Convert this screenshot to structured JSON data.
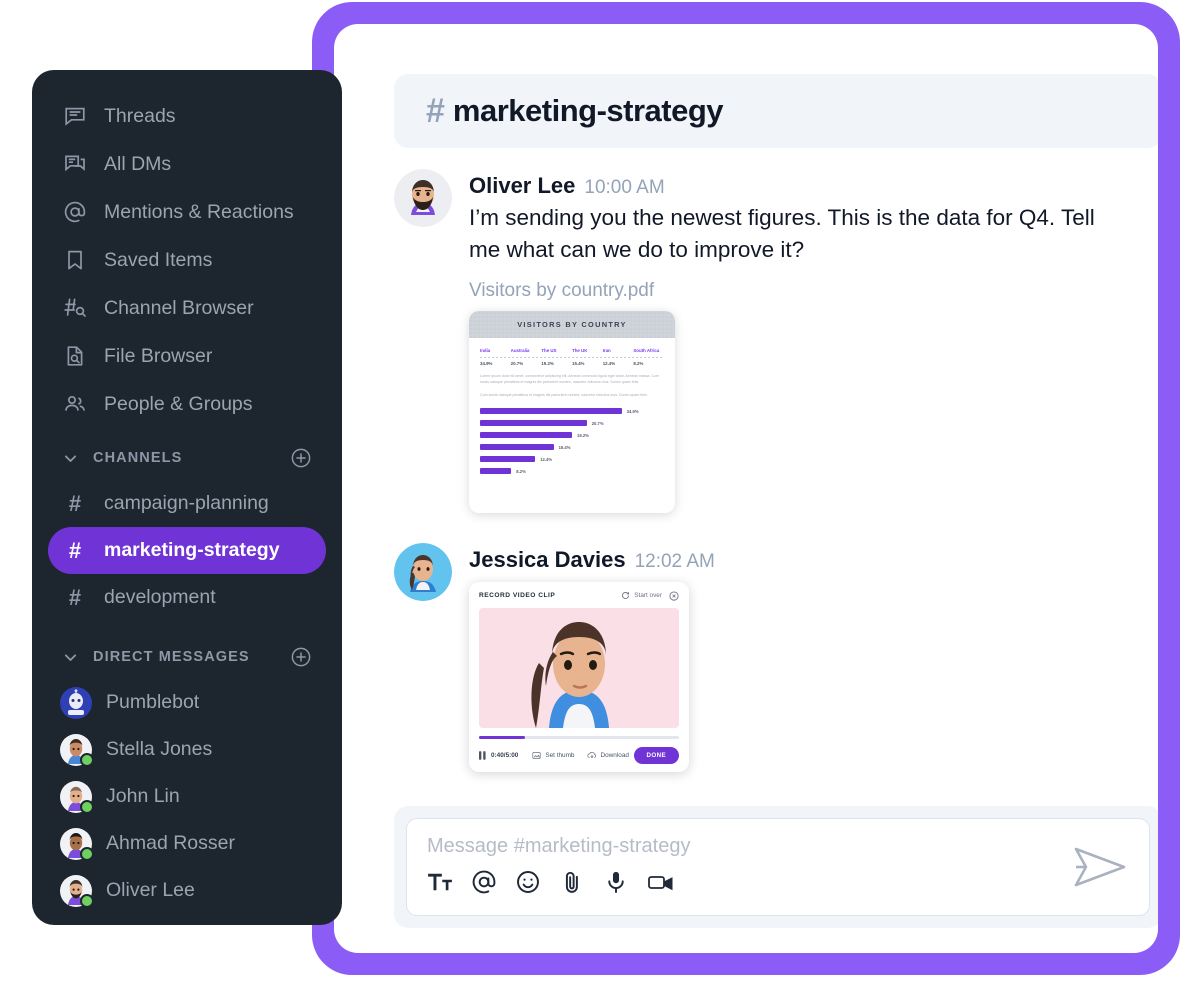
{
  "colors": {
    "frame_purple": "#8b5cf6",
    "sidebar_bg": "#1d252e",
    "accent_purple": "#7034d6",
    "header_bg": "#f1f5f9",
    "muted_text": "#9aa5b1",
    "online_green": "#6fcf5f"
  },
  "sidebar": {
    "nav_items": [
      {
        "icon": "threads-icon",
        "label": "Threads"
      },
      {
        "icon": "all-dms-icon",
        "label": "All DMs"
      },
      {
        "icon": "mentions-icon",
        "label": "Mentions & Reactions"
      },
      {
        "icon": "bookmark-icon",
        "label": "Saved Items"
      },
      {
        "icon": "channel-browser-icon",
        "label": "Channel Browser"
      },
      {
        "icon": "file-browser-icon",
        "label": "File Browser"
      },
      {
        "icon": "people-groups-icon",
        "label": "People & Groups"
      }
    ],
    "channels_section": {
      "title": "CHANNELS",
      "add_icon": "plus-circle-icon",
      "chevron_icon": "chevron-down-icon",
      "items": [
        {
          "label": "campaign-planning",
          "active": false
        },
        {
          "label": "marketing-strategy",
          "active": true
        },
        {
          "label": "development",
          "active": false
        }
      ]
    },
    "dm_section": {
      "title": "DIRECT MESSAGES",
      "add_icon": "plus-circle-icon",
      "chevron_icon": "chevron-down-icon",
      "items": [
        {
          "label": "Pumblebot",
          "online": false
        },
        {
          "label": "Stella Jones",
          "online": true
        },
        {
          "label": "John Lin",
          "online": true
        },
        {
          "label": "Ahmad Rosser",
          "online": true
        },
        {
          "label": "Oliver Lee",
          "online": true
        }
      ]
    }
  },
  "channel_header": {
    "hash": "#",
    "title": "marketing-strategy"
  },
  "messages": [
    {
      "author": "Oliver Lee",
      "time": "10:00 AM",
      "text": " I’m sending you the newest figures. This is the data for Q4. Tell me what can we do to improve it?",
      "attachment_name": "Visitors by country.pdf"
    },
    {
      "author": "Jessica Davies",
      "time": "12:02 AM",
      "text": "",
      "attachment_name": ""
    }
  ],
  "pdf_preview": {
    "band_title": "VISITORS BY COUNTRY",
    "paragraph_1": "Lorem ipsum dolor sit amet, consectetur adipiscing elit. Aenean commodo ligula eget dolor. Aenean massa. Cum sociis natoque penatibus et magnis dis parturient montes, nascetur ridiculus mus. Donec quam felis.",
    "paragraph_2": "Cum sociis natoque penatibus et magnis dis parturient montes, nascetur ridiculus mus. Donec quam felis."
  },
  "chart_data": {
    "type": "bar",
    "title": "VISITORS BY COUNTRY",
    "categories": [
      "India",
      "Australia",
      "The US",
      "The UK",
      "Iran",
      "South Africa"
    ],
    "values": [
      34.9,
      20.7,
      19.2,
      15.4,
      12.4,
      8.2
    ],
    "value_labels": [
      "34.9%",
      "20.7%",
      "19.2%",
      "15.4%",
      "12.4%",
      "8.2%"
    ],
    "xlabel": "",
    "ylabel": "",
    "xlim": [
      0,
      40
    ],
    "grid": false,
    "legend": "none",
    "orientation": "horizontal",
    "bar_color": "#7034d6"
  },
  "video_card": {
    "title": "RECORD VIDEO CLIP",
    "restart_icon": "refresh-icon",
    "start_over_label": "Start over",
    "close_icon": "close-circle-icon",
    "play_state_icon": "pause-icon",
    "time": "0:40/5:00",
    "progress_percent": 23,
    "set_thumb_icon": "image-icon",
    "set_thumb_label": "Set thumb",
    "download_icon": "download-cloud-icon",
    "download_label": "Download",
    "done_label": "DONE"
  },
  "composer": {
    "placeholder": "Message #marketing-strategy",
    "tools": [
      {
        "icon": "text-format-icon",
        "name": "text-format"
      },
      {
        "icon": "mention-icon",
        "name": "mention"
      },
      {
        "icon": "emoji-icon",
        "name": "emoji"
      },
      {
        "icon": "attachment-icon",
        "name": "attachment"
      },
      {
        "icon": "microphone-icon",
        "name": "microphone"
      },
      {
        "icon": "video-camera-icon",
        "name": "video-camera"
      }
    ],
    "send_icon": "send-icon"
  }
}
